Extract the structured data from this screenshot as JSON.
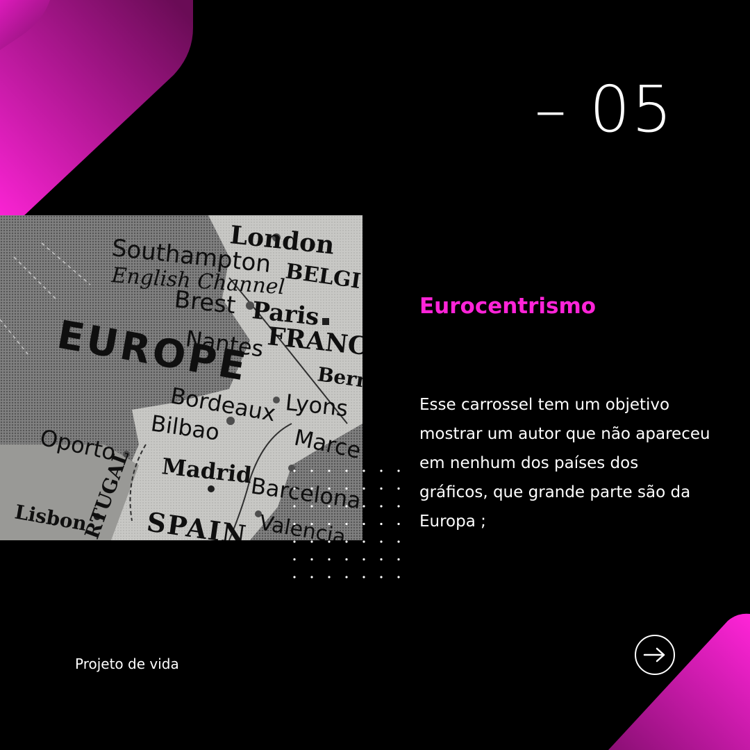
{
  "slide_number": "– 05",
  "map_image": {
    "labels": {
      "london": "London",
      "southampton": "Southampton",
      "english_channel": "English Channel",
      "belgium": "BELGI",
      "brest": "Brest",
      "paris": "Paris",
      "europe": "EUROPE",
      "nantes": "Nantes",
      "france": "FRANC",
      "bern": "Bern",
      "bordeaux": "Bordeaux",
      "lyons": "Lyons",
      "bilbao": "Bilbao",
      "oporto": "Oporto",
      "marseille": "Marce",
      "madrid": "Madrid",
      "portugal": "RTUGAL",
      "barcelona": "Barcelona",
      "lisbon": "Lisbon",
      "spain": "SPAIN",
      "valencia": "Valencia"
    }
  },
  "title": "Eurocentrismo",
  "body": "Esse carrossel tem um objetivo mostrar um autor que não apareceu em nenhum dos países  dos gráficos, que grande parte são da Europa ;",
  "footer": "Projeto de vida",
  "next_icon": "arrow-right-icon",
  "colors": {
    "background": "#000000",
    "accent": "#ff24d8",
    "gradient_dark": "#6a0c56"
  }
}
